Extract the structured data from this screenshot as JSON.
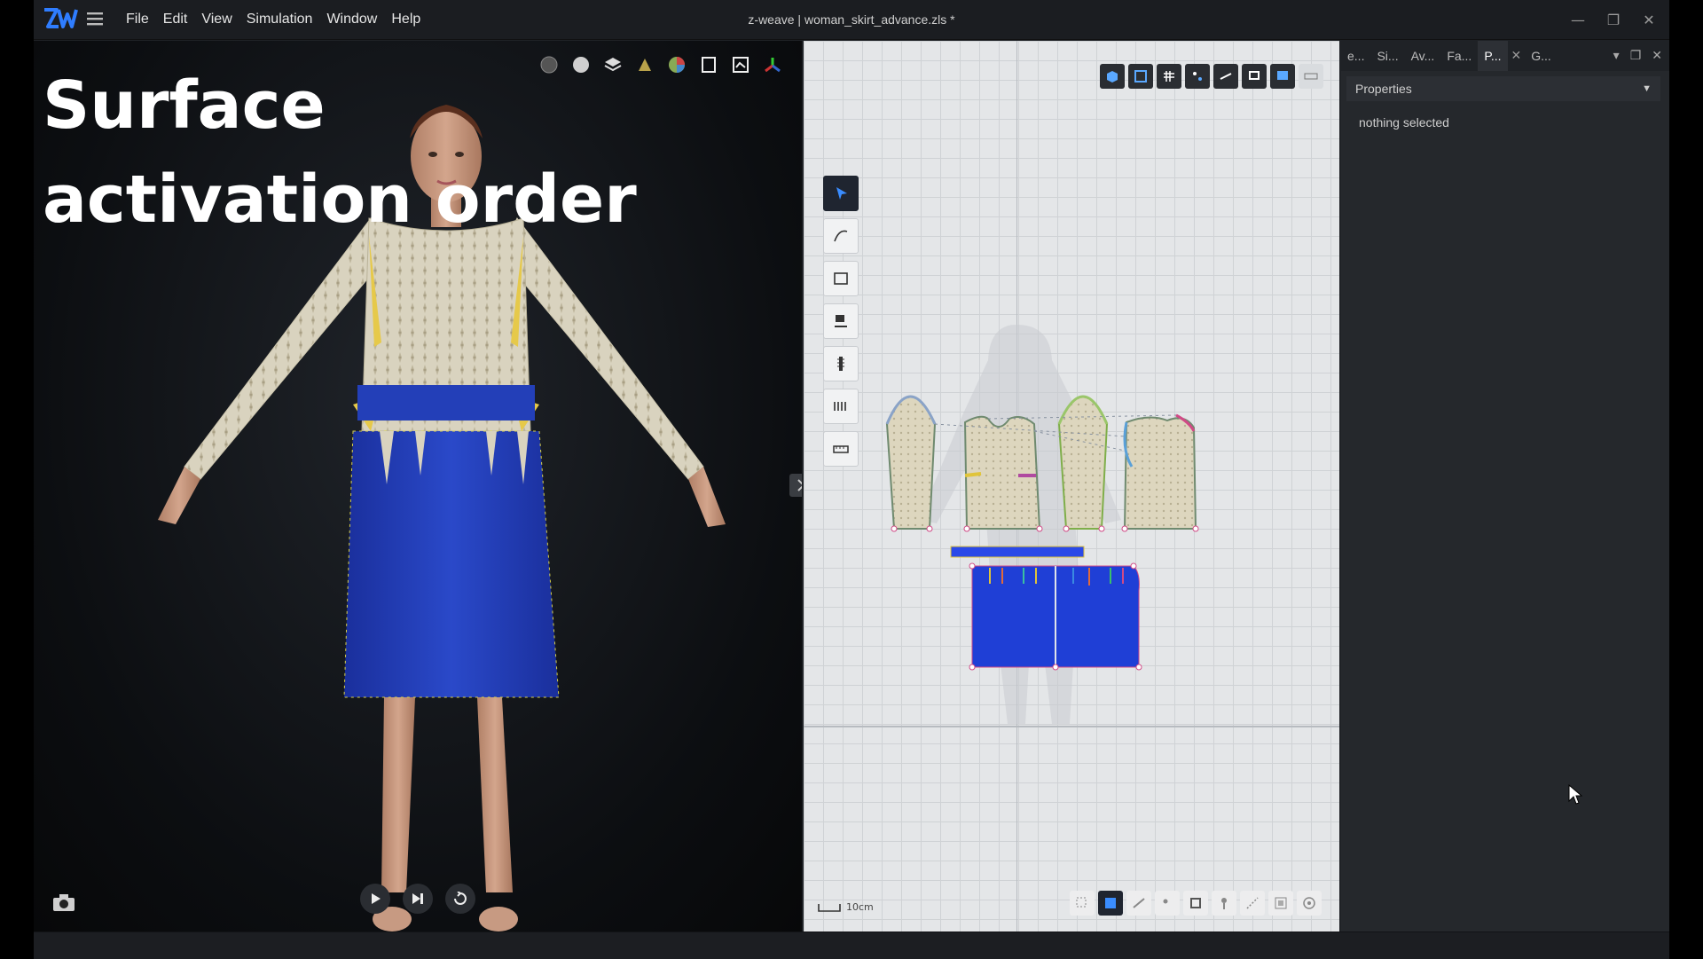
{
  "app": {
    "title": "z-weave | woman_skirt_advance.zls *",
    "logo_icon": "zw-logo-icon",
    "accent": "#2f7dff"
  },
  "menu": {
    "items": [
      "File",
      "Edit",
      "View",
      "Simulation",
      "Window",
      "Help"
    ]
  },
  "window_controls": [
    "minimize-icon",
    "maximize-icon",
    "close-icon"
  ],
  "viewport": {
    "overlay_title_line1": "Surface",
    "overlay_title_line2": "activation order",
    "toolbar_icons": [
      "render-mode-icon",
      "sphere-icon",
      "layers-icon",
      "hanger-icon",
      "color-wheel-icon",
      "frame-icon",
      "texture-icon",
      "axis-gizmo-icon"
    ],
    "playback": [
      "play-icon",
      "step-forward-icon",
      "reset-icon"
    ],
    "camera_icon": "camera-icon"
  },
  "pattern": {
    "top_toolbar_icons": [
      "3d-view-icon",
      "pattern-edit-icon",
      "grid-visibility-icon",
      "points-visibility-icon",
      "seams-visibility-icon",
      "pins-visibility-icon",
      "fabric-visibility-icon",
      "ruler-icon"
    ],
    "side_tools": [
      "select-tool-icon",
      "curve-tool-icon",
      "rectangle-tool-icon",
      "sewing-tool-icon",
      "zipper-tool-icon",
      "fold-tool-icon",
      "measure-tool-icon"
    ],
    "bottom_toolbar_icons": [
      "snap-icon",
      "fill-icon",
      "edge-icon",
      "point-icon",
      "transform-icon",
      "pin-icon",
      "line-icon",
      "region-icon",
      "target-icon"
    ],
    "scale_label": "10cm",
    "colors": {
      "fabric_top": "#d8d2bd",
      "fabric_skirt": "#1f3fd6",
      "waistband": "#2a49e8"
    }
  },
  "panel": {
    "tabs": [
      "e...",
      "Si...",
      "Av...",
      "Fa...",
      "P...",
      "G..."
    ],
    "active_tab": "P...",
    "section_title": "Properties",
    "empty_message": "nothing selected"
  }
}
